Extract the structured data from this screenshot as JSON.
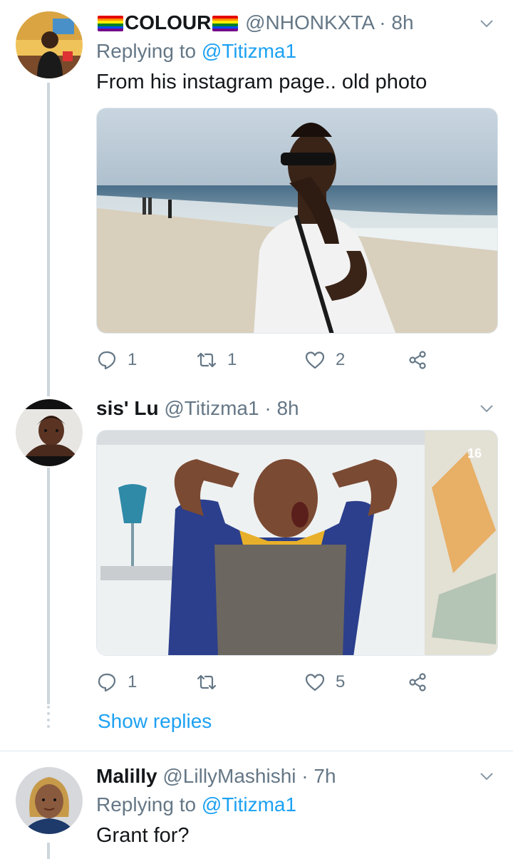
{
  "tweets": [
    {
      "display_name": "COLOUR",
      "handle": "@NHONKXTA",
      "dot": "·",
      "time": "8h",
      "replying_prefix": "Replying to",
      "replying_to": "@Titizma1",
      "text": "From his instagram page.. old photo",
      "media": "photo-man-on-beach",
      "replies": "1",
      "retweets": "1",
      "likes": "2"
    },
    {
      "display_name": "sis' Lu",
      "handle": "@Titizma1",
      "dot": "·",
      "time": "8h",
      "media": "photo-shocked-man-hands-on-head",
      "media_badge": "16",
      "replies": "1",
      "retweets": "",
      "likes": "5"
    },
    {
      "display_name": "Malilly",
      "handle": "@LillyMashishi",
      "dot": "·",
      "time": "7h",
      "replying_prefix": "Replying to",
      "replying_to": "@Titizma1",
      "text": "Grant for?"
    }
  ],
  "thread": {
    "show_replies": "Show replies"
  },
  "icons": {
    "reply": "reply-icon",
    "retweet": "retweet-icon",
    "like": "heart-icon",
    "share": "share-icon",
    "menu": "chevron-down-icon",
    "flag": "rainbow-flag-icon"
  },
  "colors": {
    "link": "#1da1f2",
    "secondary_text": "#657786",
    "primary_text": "#14171a",
    "thread_line": "#ccd6dd"
  }
}
